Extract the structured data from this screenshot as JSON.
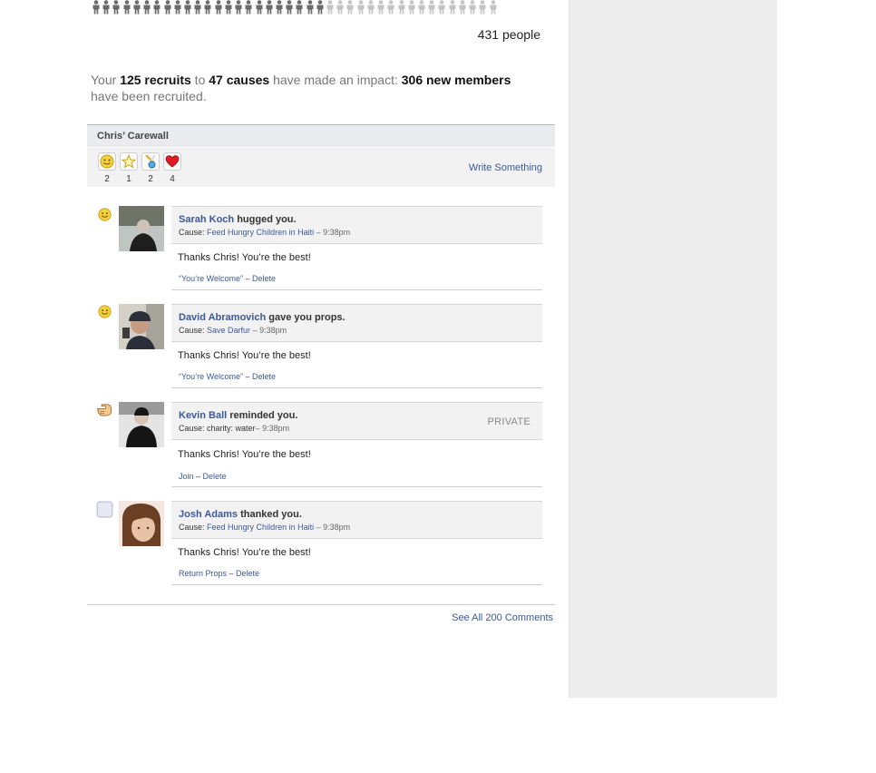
{
  "people": {
    "strip_highlighted": 23,
    "strip_total": 40,
    "count_label": "431 people"
  },
  "impact": {
    "prefix": "Your ",
    "recruits": "125 recruits",
    "mid1": " to ",
    "causes": "47 causes",
    "mid2": " have made an impact: ",
    "new_members": "306 new members",
    "suffix": " have been recruited."
  },
  "carewall": {
    "title": "Chris’ Carewall",
    "write_label": "Write Something",
    "badges": [
      {
        "icon": "smiley-icon",
        "count": "2"
      },
      {
        "icon": "star-icon",
        "count": "1"
      },
      {
        "icon": "ribbon-medal-icon",
        "count": "2"
      },
      {
        "icon": "heart-icon",
        "count": "4"
      }
    ]
  },
  "posts": [
    {
      "type_icon": "smiley-icon",
      "name": "Sarah Koch",
      "action": " hugged you.",
      "cause_label": "Cause: ",
      "cause": "Feed Hungry Children in Haiti",
      "time": " – 9:38pm",
      "private": "",
      "message": "Thanks Chris! You’re the best!",
      "action1": "“You’re Welcome”",
      "sep": " – ",
      "action2": "Delete",
      "avatar_colors": [
        "#1e1e1e",
        "#6f7468",
        "#bfc5c1"
      ]
    },
    {
      "type_icon": "smiley-icon",
      "name": "David Abramovich",
      "action": " gave you props.",
      "cause_label": "Cause: ",
      "cause": "Save Darfur",
      "time": " – 9:38pm",
      "private": "",
      "message": "Thanks Chris! You’re the best!",
      "action1": "“You’re Welcome”",
      "sep": " – ",
      "action2": "Delete",
      "avatar_colors": [
        "#2b2f3a",
        "#a6a39b",
        "#d4d0c8"
      ]
    },
    {
      "type_icon": "pointing-hand-icon",
      "name": "Kevin Ball",
      "action": " reminded you.",
      "cause_label": "Cause: ",
      "cause": "charity: water",
      "time": "– 9:38pm",
      "private": "PRIVATE",
      "message": "Thanks Chris! You’re the best!",
      "action1": "Join",
      "sep": " – ",
      "action2": "Delete",
      "avatar_colors": [
        "#151515",
        "#9a9a9a",
        "#e4e4e4"
      ]
    },
    {
      "type_icon": "blank-square-icon",
      "name": "Josh Adams",
      "action": " thanked you.",
      "cause_label": "Cause: ",
      "cause": "Feed Hungry Children in Haiti",
      "time": " – 9:38pm",
      "private": "",
      "message": "Thanks Chris! You’re the best!",
      "action1": "Return Props",
      "sep": " – ",
      "action2": "Delete",
      "avatar_colors": [
        "#6b3f24",
        "#e8c2a6",
        "#f3e7df"
      ]
    }
  ],
  "footer": {
    "see_all": "See All 200 Comments"
  },
  "colors": {
    "link": "#3b5998",
    "sidebar_bg": "#ededed",
    "header_bg": "#e9ebef"
  }
}
